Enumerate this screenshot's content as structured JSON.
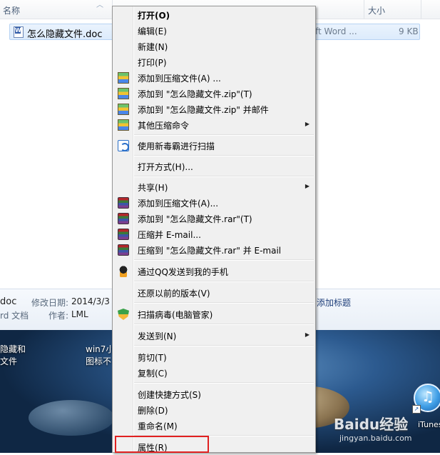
{
  "explorer": {
    "columns": {
      "name": "名称",
      "size": "大小"
    },
    "file": {
      "name": "怎么隐藏文件.doc",
      "type": "ft Word ...",
      "size": "9 KB"
    },
    "details": {
      "name": "doc",
      "type": "rd 文档",
      "modified_label": "修改日期:",
      "modified_value": "2014/3/3",
      "author_label": "作者:",
      "author_value": "LML",
      "tags": "添加标题"
    }
  },
  "desktop": {
    "icon_text_1a": "隐藏和",
    "icon_text_1b": "文件",
    "icon_text_2a": "win7小",
    "icon_text_2b": "图标不",
    "itunes_label": "iTunes",
    "watermark": "Baidu经验",
    "watermark_sub": "jingyan.baidu.com"
  },
  "context_menu": {
    "items": [
      {
        "label": "打开(O)",
        "bold": true,
        "icon": ""
      },
      {
        "label": "编辑(E)",
        "icon": ""
      },
      {
        "label": "新建(N)",
        "icon": ""
      },
      {
        "label": "打印(P)",
        "icon": ""
      },
      {
        "label": "添加到压缩文件(A) ...",
        "icon": "zip-archive-icon"
      },
      {
        "label": "添加到 \"怎么隐藏文件.zip\"(T)",
        "icon": "zip-archive-icon"
      },
      {
        "label": "添加到 \"怎么隐藏文件.zip\" 并邮件",
        "icon": "zip-archive-icon"
      },
      {
        "label": "其他压缩命令",
        "icon": "zip-archive-icon",
        "submenu": true
      },
      {
        "label": "使用新毒霸进行扫描",
        "icon": "antivirus-icon"
      },
      {
        "label": "打开方式(H)...",
        "icon": ""
      },
      {
        "label": "共享(H)",
        "icon": "",
        "submenu": true
      },
      {
        "label": "添加到压缩文件(A)...",
        "icon": "winrar-icon"
      },
      {
        "label": "添加到 \"怎么隐藏文件.rar\"(T)",
        "icon": "winrar-icon"
      },
      {
        "label": "压缩并 E-mail...",
        "icon": "winrar-icon"
      },
      {
        "label": "压缩到 \"怎么隐藏文件.rar\" 并 E-mail",
        "icon": "winrar-icon"
      },
      {
        "label": "通过QQ发送到我的手机",
        "icon": "qq-penguin-icon"
      },
      {
        "label": "还原以前的版本(V)",
        "icon": ""
      },
      {
        "label": "扫描病毒(电脑管家)",
        "icon": "pc-manager-shield-icon"
      },
      {
        "label": "发送到(N)",
        "icon": "",
        "submenu": true
      },
      {
        "label": "剪切(T)",
        "icon": ""
      },
      {
        "label": "复制(C)",
        "icon": ""
      },
      {
        "label": "创建快捷方式(S)",
        "icon": ""
      },
      {
        "label": "删除(D)",
        "icon": ""
      },
      {
        "label": "重命名(M)",
        "icon": ""
      },
      {
        "label": "属性(R)",
        "icon": ""
      }
    ],
    "highlight_color": "#e02020"
  }
}
